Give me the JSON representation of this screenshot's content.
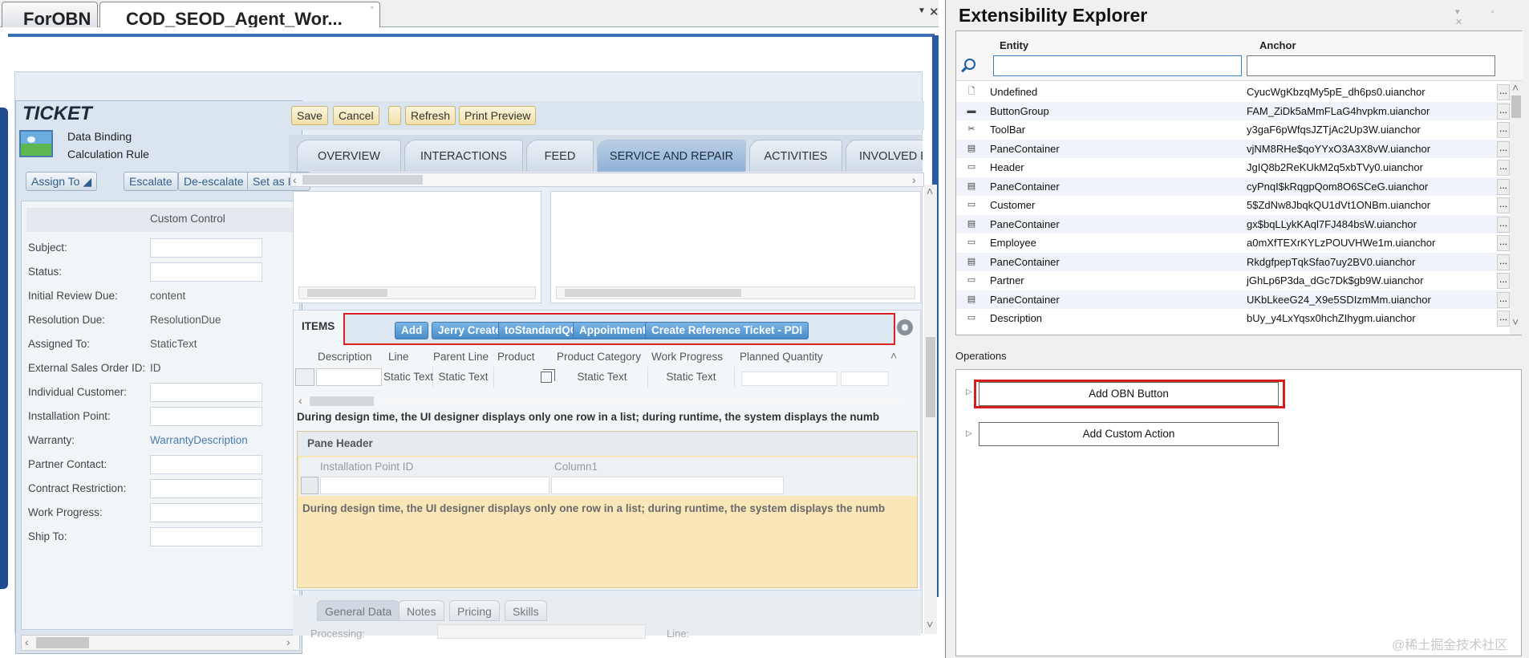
{
  "doc_tabs": {
    "first": "ForOBN",
    "second": "COD_SEOD_Agent_Wor..."
  },
  "ticket": {
    "title": "TICKET",
    "line1": "Data Binding",
    "line2": "Calculation Rule",
    "toolbar": [
      "Assign To",
      "Escalate",
      "De-escalate",
      "Set as Irre"
    ],
    "custom_control": "Custom Control",
    "fields": [
      {
        "label": "Subject:",
        "value": ""
      },
      {
        "label": "Status:",
        "value": ""
      },
      {
        "label": "Initial Review Due:",
        "value": "content"
      },
      {
        "label": "Resolution Due:",
        "value": "ResolutionDue"
      },
      {
        "label": "Assigned To:",
        "value": "StaticText"
      },
      {
        "label": "External Sales Order ID:",
        "value": "ID"
      },
      {
        "label": "Individual Customer:",
        "value": ""
      },
      {
        "label": "Installation Point:",
        "value": ""
      },
      {
        "label": "Warranty:",
        "value": "WarrantyDescription"
      },
      {
        "label": "Partner Contact:",
        "value": ""
      },
      {
        "label": "Contract Restriction:",
        "value": ""
      },
      {
        "label": "Work Progress:",
        "value": ""
      },
      {
        "label": "Ship To:",
        "value": ""
      }
    ]
  },
  "main_toolbar": [
    "Save",
    "Cancel",
    "",
    "Refresh",
    "Print Preview"
  ],
  "facets": [
    "OVERVIEW",
    "INTERACTIONS",
    "FEED",
    "SERVICE AND REPAIR",
    "ACTIVITIES",
    "INVOLVED P"
  ],
  "items": {
    "title": "ITEMS",
    "buttons": [
      "Add",
      "Jerry Create",
      "toStandardQC",
      "Appointment",
      "Create Reference Ticket - PDI"
    ],
    "columns": [
      "Description",
      "Line",
      "Parent Line",
      "Product",
      "Product Category",
      "Work Progress",
      "Planned Quantity"
    ],
    "cells": [
      "Static Text",
      "Static Text",
      "Static Text",
      "Static Text"
    ],
    "note": "During design time, the UI designer displays only one row in a list; during runtime, the system displays the numb"
  },
  "pane": {
    "header": "Pane Header",
    "col1": "Installation Point ID",
    "col2": "Column1",
    "note": "During design time, the UI designer displays only one row in a list; during runtime, the system displays the numb"
  },
  "bottom_tabs": [
    "General Data",
    "Notes",
    "Pricing",
    "Skills"
  ],
  "bottom_fields": {
    "processing": "Processing:",
    "line": "Line:"
  },
  "explorer": {
    "title": "Extensibility Explorer",
    "col_entity": "Entity",
    "col_anchor": "Anchor",
    "rows": [
      {
        "entity": "Undefined",
        "anchor": "CyucWgKbzqMy5pE_dh6ps0.uianchor",
        "icon": "document-icon"
      },
      {
        "entity": "ButtonGroup",
        "anchor": "FAM_ZiDk5aMmFLaG4hvpkm.uianchor",
        "icon": "buttongroup-icon"
      },
      {
        "entity": "ToolBar",
        "anchor": "y3gaF6pWfqsJZTjAc2Up3W.uianchor",
        "icon": "tools-icon"
      },
      {
        "entity": "PaneContainer",
        "anchor": "vjNM8RHe$qoYYxO3A3X8vW.uianchor",
        "icon": "pane-icon"
      },
      {
        "entity": "Header",
        "anchor": "JgIQ8b2ReKUkM2q5xbTVy0.uianchor",
        "icon": "window-icon"
      },
      {
        "entity": "PaneContainer",
        "anchor": "cyPnqI$kRqgpQom8O6SCeG.uianchor",
        "icon": "pane-icon"
      },
      {
        "entity": "Customer",
        "anchor": "5$ZdNw8JbqkQU1dVt1ONBm.uianchor",
        "icon": "window-icon"
      },
      {
        "entity": "PaneContainer",
        "anchor": "gx$bqLLykKAql7FJ484bsW.uianchor",
        "icon": "pane-icon"
      },
      {
        "entity": "Employee",
        "anchor": "a0mXfTEXrKYLzPOUVHWe1m.uianchor",
        "icon": "window-icon"
      },
      {
        "entity": "PaneContainer",
        "anchor": "RkdgfpepTqkSfao7uy2BV0.uianchor",
        "icon": "pane-icon"
      },
      {
        "entity": "Partner",
        "anchor": "jGhLp6P3da_dGc7Dk$gb9W.uianchor",
        "icon": "window-icon"
      },
      {
        "entity": "PaneContainer",
        "anchor": "UKbLkeeG24_X9e5SDIzmMm.uianchor",
        "icon": "pane-icon"
      },
      {
        "entity": "Description",
        "anchor": "bUy_y4LxYqsx0hchZIhygm.uianchor",
        "icon": "window-icon"
      }
    ],
    "operations_label": "Operations",
    "operations": [
      "Add OBN Button",
      "Add Custom Action"
    ]
  },
  "watermark": "@稀土掘金技术社区"
}
